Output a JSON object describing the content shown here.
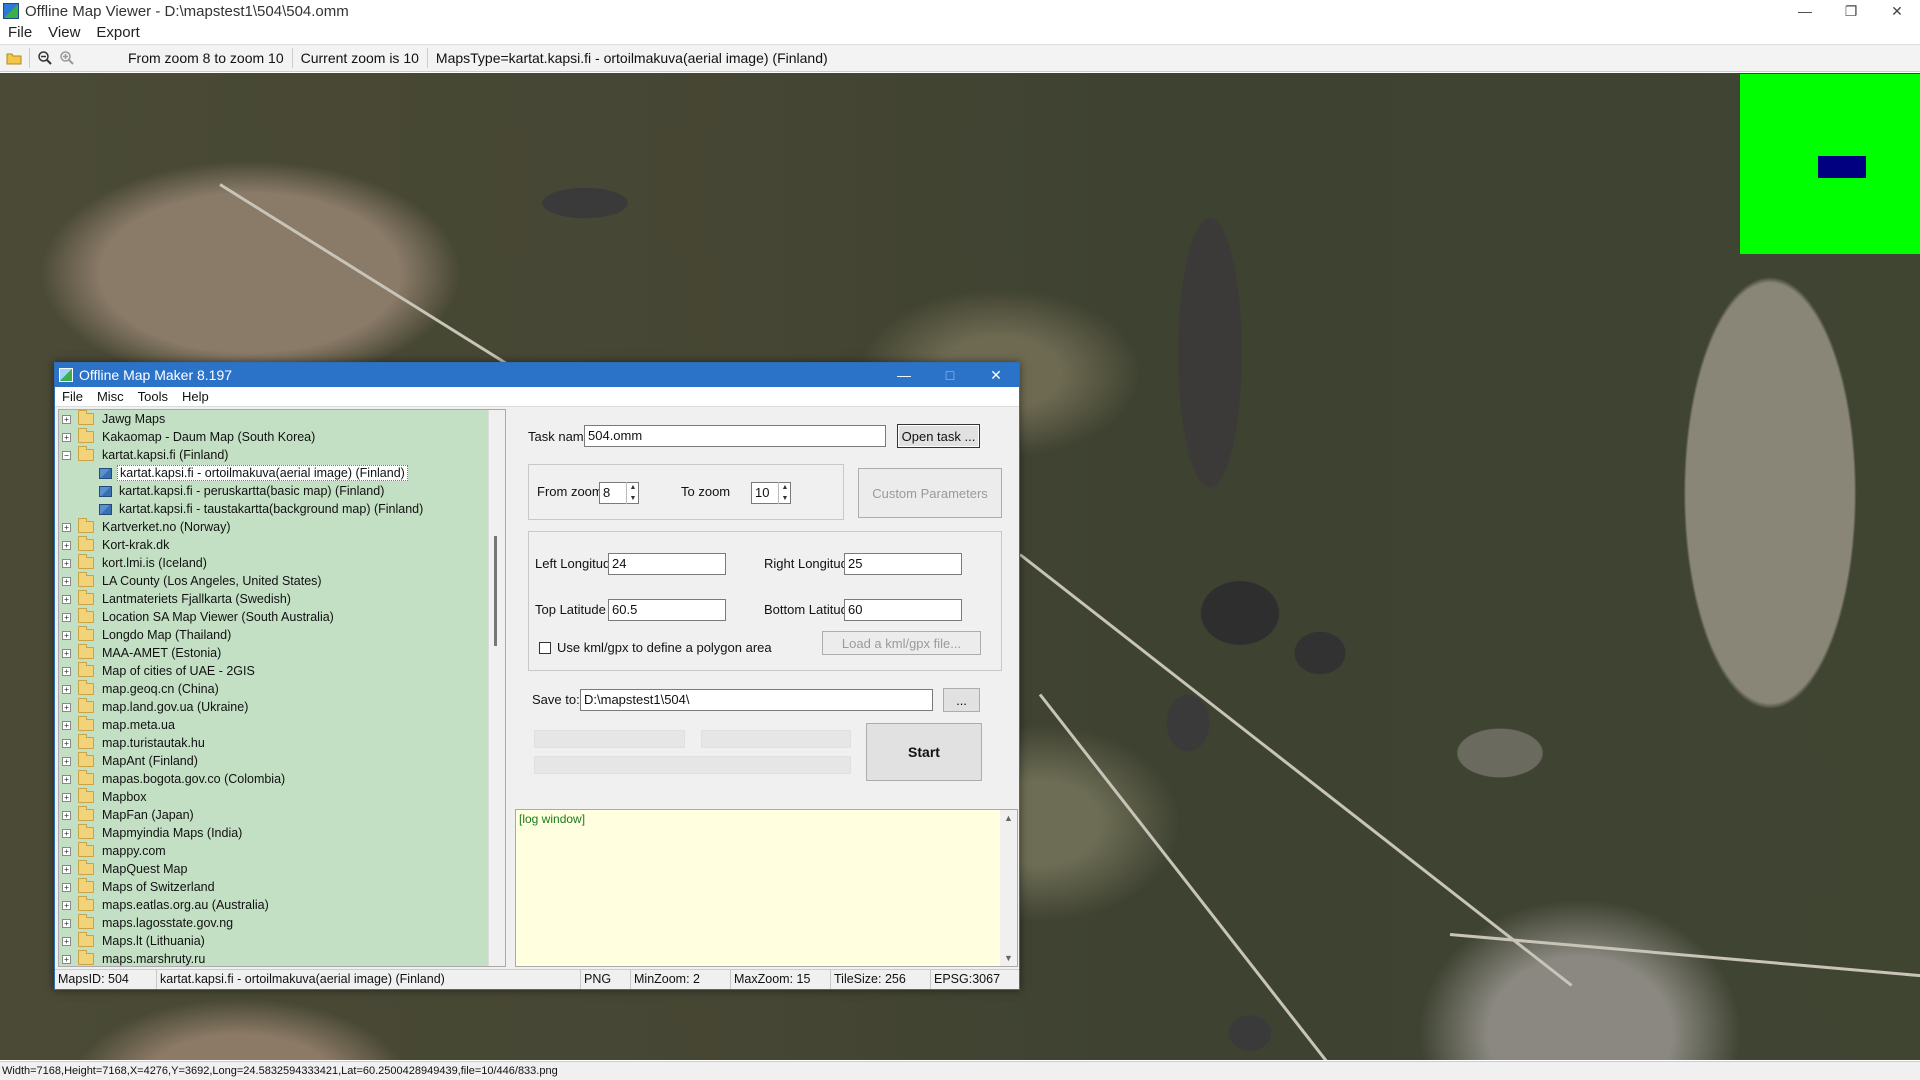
{
  "app": {
    "title": "Offline Map Viewer - D:\\mapstest1\\504\\504.omm",
    "menu": [
      "File",
      "View",
      "Export"
    ],
    "toolbar_info": {
      "zoom_range": "From zoom 8 to zoom 10",
      "current_zoom": "Current zoom is 10",
      "maps_type": "MapsType=kartat.kapsi.fi - ortoilmakuva(aerial image) (Finland)"
    },
    "status": "Width=7168,Height=7168,X=4276,Y=3692,Long=24.5832594333421,Lat=60.2500428949439,file=10/446/833.png"
  },
  "dialog": {
    "title": "Offline Map Maker 8.197",
    "menu": [
      "File",
      "Misc",
      "Tools",
      "Help"
    ],
    "tree": [
      {
        "label": "Jawg Maps",
        "type": "folder",
        "expander": "+"
      },
      {
        "label": "Kakaomap - Daum Map (South Korea)",
        "type": "folder",
        "expander": "+"
      },
      {
        "label": "kartat.kapsi.fi (Finland)",
        "type": "folder",
        "expander": "-"
      },
      {
        "label": "kartat.kapsi.fi - ortoilmakuva(aerial image) (Finland)",
        "type": "map",
        "selected": true
      },
      {
        "label": "kartat.kapsi.fi - peruskartta(basic map) (Finland)",
        "type": "map"
      },
      {
        "label": "kartat.kapsi.fi - taustakartta(background map) (Finland)",
        "type": "map"
      },
      {
        "label": "Kartverket.no (Norway)",
        "type": "folder",
        "expander": "+"
      },
      {
        "label": "Kort-krak.dk",
        "type": "folder",
        "expander": "+"
      },
      {
        "label": "kort.lmi.is (Iceland)",
        "type": "folder",
        "expander": "+"
      },
      {
        "label": "LA County (Los Angeles, United States)",
        "type": "folder",
        "expander": "+"
      },
      {
        "label": "Lantmateriets Fjallkarta (Swedish)",
        "type": "folder",
        "expander": "+"
      },
      {
        "label": "Location SA Map Viewer (South Australia)",
        "type": "folder",
        "expander": "+"
      },
      {
        "label": "Longdo Map (Thailand)",
        "type": "folder",
        "expander": "+"
      },
      {
        "label": "MAA-AMET (Estonia)",
        "type": "folder",
        "expander": "+"
      },
      {
        "label": "Map of cities of UAE - 2GIS",
        "type": "folder",
        "expander": "+"
      },
      {
        "label": "map.geoq.cn (China)",
        "type": "folder",
        "expander": "+"
      },
      {
        "label": "map.land.gov.ua (Ukraine)",
        "type": "folder",
        "expander": "+"
      },
      {
        "label": "map.meta.ua",
        "type": "folder",
        "expander": "+"
      },
      {
        "label": "map.turistautak.hu",
        "type": "folder",
        "expander": "+"
      },
      {
        "label": "MapAnt (Finland)",
        "type": "folder",
        "expander": "+"
      },
      {
        "label": "mapas.bogota.gov.co (Colombia)",
        "type": "folder",
        "expander": "+"
      },
      {
        "label": "Mapbox",
        "type": "folder",
        "expander": "+"
      },
      {
        "label": "MapFan (Japan)",
        "type": "folder",
        "expander": "+"
      },
      {
        "label": "Mapmyindia Maps (India)",
        "type": "folder",
        "expander": "+"
      },
      {
        "label": "mappy.com",
        "type": "folder",
        "expander": "+"
      },
      {
        "label": "MapQuest Map",
        "type": "folder",
        "expander": "+"
      },
      {
        "label": "Maps of Switzerland",
        "type": "folder",
        "expander": "+"
      },
      {
        "label": "maps.eatlas.org.au (Australia)",
        "type": "folder",
        "expander": "+"
      },
      {
        "label": "maps.lagosstate.gov.ng",
        "type": "folder",
        "expander": "+"
      },
      {
        "label": "Maps.lt (Lithuania)",
        "type": "folder",
        "expander": "+"
      },
      {
        "label": "maps.marshruty.ru",
        "type": "folder",
        "expander": "+"
      }
    ],
    "form": {
      "task_name_label": "Task name",
      "task_name_value": "504.omm",
      "open_task_button": "Open task ...",
      "from_zoom_label": "From zoom",
      "from_zoom_value": "8",
      "to_zoom_label": "To zoom",
      "to_zoom_value": "10",
      "custom_params_button": "Custom Parameters",
      "left_longitude_label": "Left Longitude",
      "left_longitude_value": "24",
      "right_longitude_label": "Right Longitude",
      "right_longitude_value": "25",
      "top_latitude_label": "Top Latitude",
      "top_latitude_value": "60.5",
      "bottom_latitude_label": "Bottom Latitude",
      "bottom_latitude_value": "60",
      "kml_checkbox_label": "Use kml/gpx to define a polygon area",
      "kml_checked": false,
      "load_kml_button": "Load a kml/gpx file...",
      "save_to_label": "Save to:",
      "save_to_value": "D:\\mapstest1\\504\\",
      "browse_button": "...",
      "start_button": "Start",
      "progress": [
        0,
        0,
        0
      ]
    },
    "log_text": "[log window]",
    "status": {
      "maps_id": "MapsID: 504",
      "map_name": "kartat.kapsi.fi - ortoilmakuva(aerial image) (Finland)",
      "format": "PNG",
      "min_zoom": "MinZoom: 2",
      "max_zoom": "MaxZoom: 15",
      "tile_size": "TileSize: 256",
      "epsg": "EPSG:3067"
    }
  },
  "colors": {
    "tree_bg": "#c4e0c4",
    "log_bg": "#ffffe0",
    "overview_bg": "#00ff00",
    "overview_view": "#000080",
    "dialog_title": "#2b73c9"
  }
}
